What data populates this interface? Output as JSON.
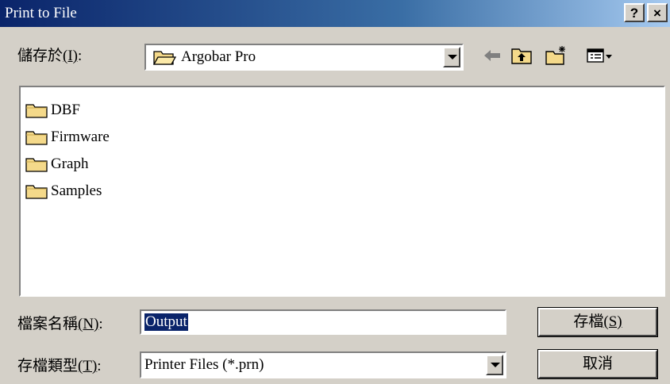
{
  "window": {
    "title": "Print to File",
    "help_label": "?",
    "close_label": "×"
  },
  "save_in": {
    "label_prefix": "儲存於",
    "label_key": "(I)",
    "label_suffix": ":",
    "value": "Argobar Pro",
    "icon": "open-folder-icon"
  },
  "toolbar": {
    "back_icon": "back-arrow-icon",
    "up_icon": "up-folder-icon",
    "new_folder_icon": "new-folder-icon",
    "view_icon": "view-menu-icon"
  },
  "files": [
    {
      "name": "DBF",
      "icon": "folder-icon"
    },
    {
      "name": "Firmware",
      "icon": "folder-icon"
    },
    {
      "name": "Graph",
      "icon": "folder-icon"
    },
    {
      "name": "Samples",
      "icon": "folder-icon"
    }
  ],
  "filename": {
    "label_prefix": "檔案名稱",
    "label_key": "(N)",
    "label_suffix": ":",
    "value": "Output"
  },
  "filetype": {
    "label_prefix": "存檔類型",
    "label_key": "(T)",
    "label_suffix": ":",
    "value": "Printer Files (*.prn)"
  },
  "buttons": {
    "save_prefix": "存檔",
    "save_key": "(S)",
    "cancel": "取消"
  },
  "colors": {
    "title_start": "#0a246a",
    "title_end": "#a6caf0",
    "face": "#d4d0c8",
    "folder": "#f4d98a"
  }
}
